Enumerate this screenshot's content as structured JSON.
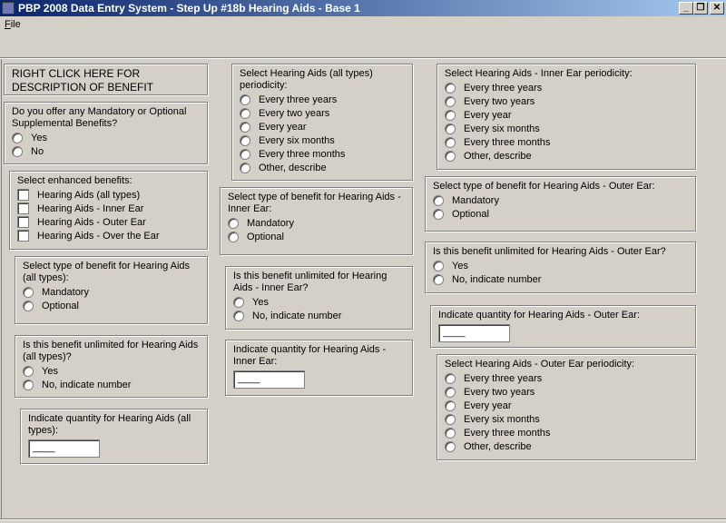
{
  "window": {
    "title": "PBP 2008 Data Entry System - Step Up #18b Hearing Aids - Base 1",
    "buttons": {
      "minimize": "_",
      "restore": "❐",
      "close": "✕"
    }
  },
  "menu": {
    "file_label_underlined": "F",
    "file_label_rest": "ile"
  },
  "description_panel": {
    "text": "RIGHT CLICK HERE FOR DESCRIPTION OF BENEFIT"
  },
  "offer": {
    "question": "Do you offer any Mandatory or Optional Supplemental Benefits?",
    "options": [
      "Yes",
      "No"
    ]
  },
  "enhanced": {
    "question": "Select enhanced benefits:",
    "options": [
      "Hearing Aids (all types)",
      "Hearing Aids - Inner Ear",
      "Hearing Aids - Outer Ear",
      "Hearing Aids - Over the Ear"
    ]
  },
  "all_type": {
    "question": "Select type of benefit for Hearing Aids (all types):",
    "options": [
      "Mandatory",
      "Optional"
    ]
  },
  "all_unlimited": {
    "question": "Is this benefit unlimited for Hearing Aids (all types)?",
    "options": [
      "Yes",
      "No, indicate number"
    ]
  },
  "all_quantity": {
    "question": "Indicate quantity for Hearing Aids (all types):",
    "value": "____"
  },
  "all_periodicity": {
    "question": "Select Hearing Aids (all types) periodicity:",
    "options": [
      "Every three years",
      "Every two years",
      "Every year",
      "Every six months",
      "Every three months",
      "Other, describe"
    ]
  },
  "inner_type": {
    "question": "Select type of benefit for Hearing Aids - Inner Ear:",
    "options": [
      "Mandatory",
      "Optional"
    ]
  },
  "inner_unlimited": {
    "question": "Is this benefit unlimited for Hearing Aids - Inner Ear?",
    "options": [
      "Yes",
      "No, indicate number"
    ]
  },
  "inner_quantity": {
    "question": "Indicate quantity for Hearing Aids - Inner Ear:",
    "value": "____"
  },
  "inner_periodicity": {
    "question": "Select Hearing Aids - Inner Ear periodicity:",
    "options": [
      "Every three years",
      "Every two years",
      "Every year",
      "Every six months",
      "Every three months",
      "Other, describe"
    ]
  },
  "outer_type": {
    "question": "Select type of benefit for Hearing Aids - Outer Ear:",
    "options": [
      "Mandatory",
      "Optional"
    ]
  },
  "outer_unlimited": {
    "question": "Is this benefit unlimited for Hearing Aids - Outer Ear?",
    "options": [
      "Yes",
      "No, indicate number"
    ]
  },
  "outer_quantity": {
    "question": "Indicate quantity for Hearing Aids - Outer Ear:",
    "value": "____"
  },
  "outer_periodicity": {
    "question": "Select Hearing Aids - Outer Ear periodicity:",
    "options": [
      "Every three years",
      "Every two years",
      "Every year",
      "Every six months",
      "Every three months",
      "Other, describe"
    ]
  }
}
